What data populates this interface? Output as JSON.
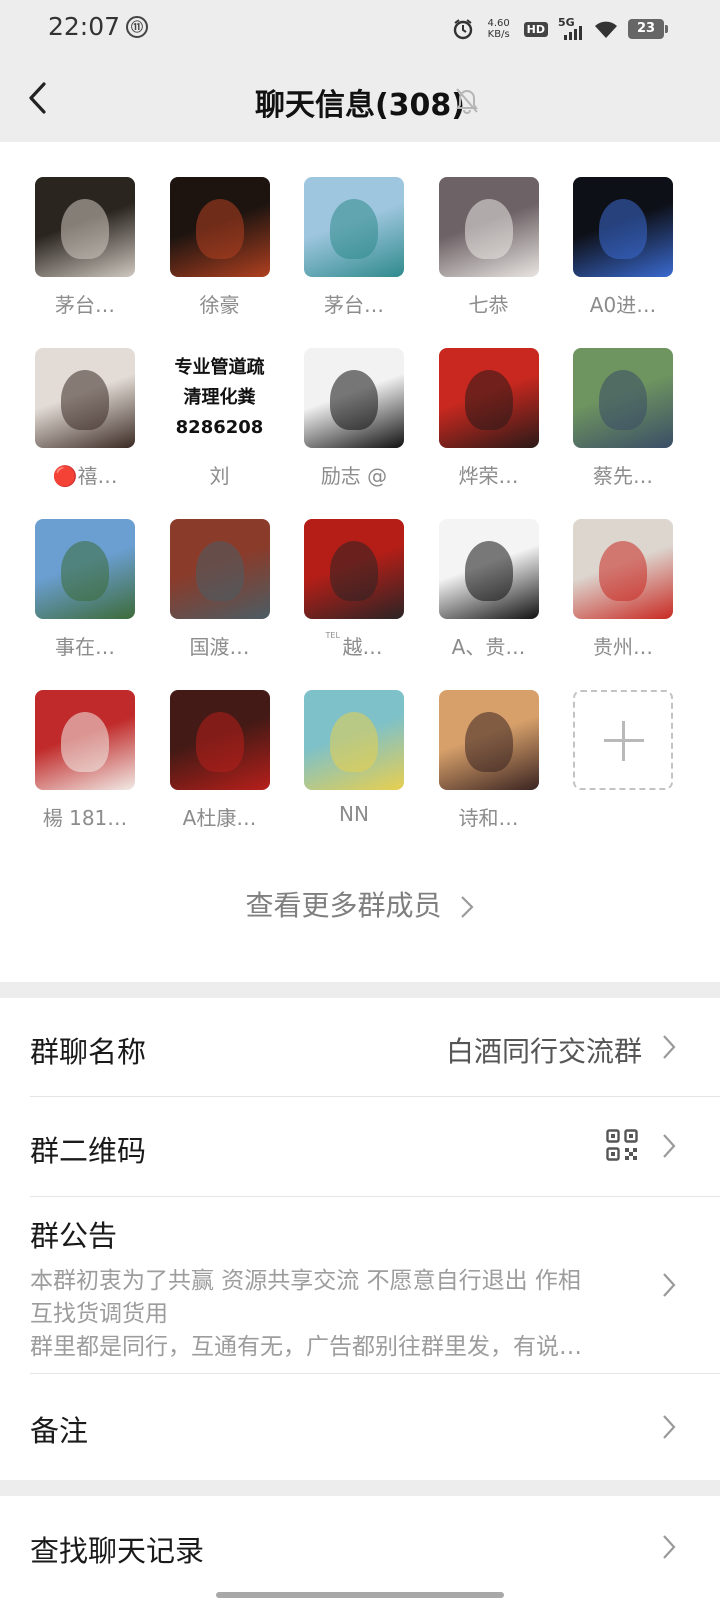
{
  "status_bar": {
    "time": "22:07",
    "badge": "⑪",
    "net_speed_value": "4.60",
    "net_speed_unit": "KB/s",
    "hd_label": "HD",
    "network": "5G",
    "battery": "23"
  },
  "header": {
    "title": "聊天信息(308)"
  },
  "members": [
    {
      "name": "茅台…",
      "avatar": "elderly-man-photo",
      "colors": [
        "#2b2520",
        "#cfc8c0"
      ]
    },
    {
      "name": "徐豪",
      "avatar": "building-night-photo",
      "colors": [
        "#1d1410",
        "#b04020"
      ]
    },
    {
      "name": "茅台…",
      "avatar": "lake-landscape-photo",
      "colors": [
        "#9ec6de",
        "#2f8a8d"
      ]
    },
    {
      "name": "七恭",
      "avatar": "fox-mask-illustration",
      "colors": [
        "#6d6266",
        "#e9e5e2"
      ]
    },
    {
      "name": "A0进…",
      "avatar": "bottles-photo",
      "colors": [
        "#0e1018",
        "#3a6ad0"
      ]
    },
    {
      "name": "🔴禧…",
      "avatar": "woman-portrait-photo",
      "colors": [
        "#e3dcd6",
        "#3b2a24"
      ]
    },
    {
      "name": "刘",
      "avatar": "text-sign-image",
      "colors": [
        "#ffffff",
        "#111111"
      ],
      "sign_lines": [
        "专业管道疏",
        "清理化粪",
        "8286208"
      ]
    },
    {
      "name": "励志 @",
      "avatar": "calligraphy-image",
      "colors": [
        "#f2f2f2",
        "#111111"
      ]
    },
    {
      "name": "烨荣…",
      "avatar": "red-poster-portrait",
      "colors": [
        "#c8281f",
        "#2a1a18"
      ]
    },
    {
      "name": "蔡先…",
      "avatar": "two-men-photo",
      "colors": [
        "#6e9460",
        "#3a4d66"
      ]
    },
    {
      "name": "事在…",
      "avatar": "wind-turbine-photo",
      "colors": [
        "#6b9fd2",
        "#3d6b39"
      ]
    },
    {
      "name": "国渡…",
      "avatar": "man-portrait-photo",
      "colors": [
        "#8a3b2a",
        "#4b5d64"
      ]
    },
    {
      "name": "越…",
      "avatar": "flag-artwork",
      "colors": [
        "#b51e17",
        "#2b2425"
      ],
      "prefix": "TEL"
    },
    {
      "name": "A、贵…",
      "avatar": "man-dark-shirt-photo",
      "colors": [
        "#f4f4f4",
        "#121212"
      ]
    },
    {
      "name": "贵州…",
      "avatar": "liquor-mascot-photo",
      "colors": [
        "#dcd6cf",
        "#c92a23"
      ]
    },
    {
      "name": "楊 181…",
      "avatar": "group-photo-red",
      "colors": [
        "#c02a2a",
        "#f1ebe6"
      ]
    },
    {
      "name": "A杜康…",
      "avatar": "wine-jar-photo",
      "colors": [
        "#431a15",
        "#b71f1b"
      ]
    },
    {
      "name": "NN",
      "avatar": "cartoon-scooter-illustration",
      "colors": [
        "#7fc1c8",
        "#e8cf4f"
      ]
    },
    {
      "name": "诗和…",
      "avatar": "tiananmen-photo",
      "colors": [
        "#d7a06a",
        "#3b2422"
      ]
    }
  ],
  "more_members_label": "查看更多群成员",
  "settings": {
    "group_name_label": "群聊名称",
    "group_name_value": "白酒同行交流群",
    "qr_label": "群二维码",
    "notice_label": "群公告",
    "notice_lines": [
      "本群初衷为了共赢 资源共享交流 不愿意自行退出  作相",
      "互找货调货用",
      "群里都是同行，互通有无，广告都别往群里发，有说…"
    ],
    "remark_label": "备注",
    "search_label": "查找聊天记录"
  }
}
